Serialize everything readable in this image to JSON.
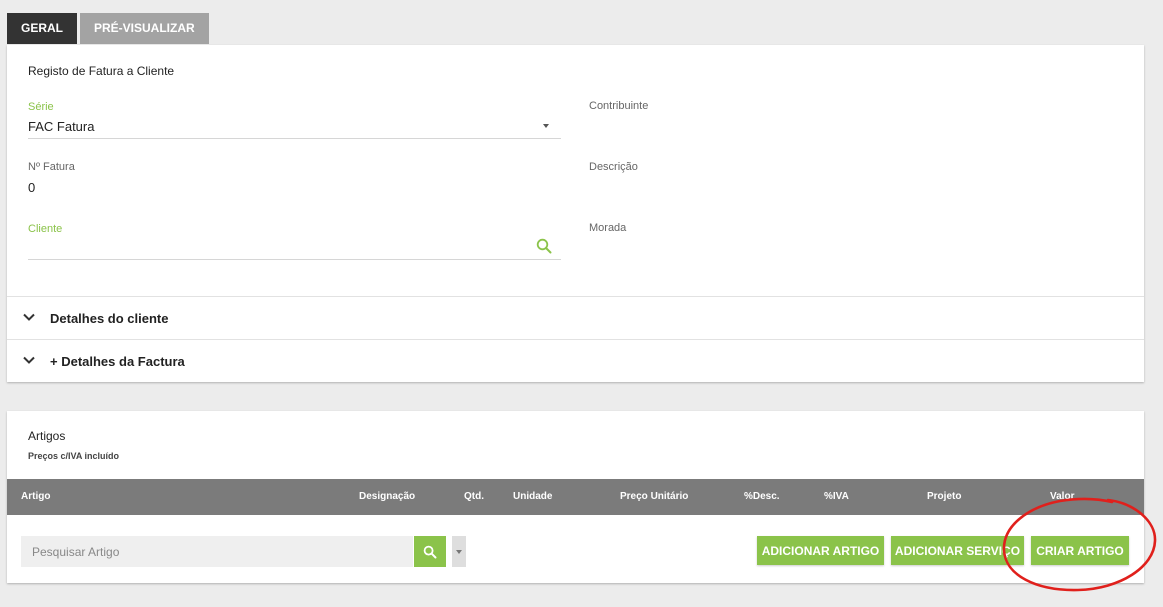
{
  "tabs": [
    {
      "label": "GERAL",
      "active": true
    },
    {
      "label": "PRÉ-VISUALIZAR",
      "active": false
    }
  ],
  "registo": {
    "title": "Registo de Fatura a Cliente",
    "serie": {
      "label": "Série",
      "value": "FAC Fatura"
    },
    "n_fatura": {
      "label": "Nº Fatura",
      "value": "0"
    },
    "cliente": {
      "label": "Cliente",
      "value": ""
    },
    "contribuinte": {
      "label": "Contribuinte"
    },
    "descricao": {
      "label": "Descrição"
    },
    "morada": {
      "label": "Morada"
    },
    "detalhes_cliente": "Detalhes do cliente",
    "detalhes_factura": "+ Detalhes da Factura"
  },
  "artigos": {
    "title": "Artigos",
    "subtitle": "Preços c/IVA incluído",
    "columns": [
      "Artigo",
      "Designação",
      "Qtd.",
      "Unidade",
      "Preço Unitário",
      "%Desc.",
      "%IVA",
      "Projeto",
      "Valor"
    ],
    "search_placeholder": "Pesquisar Artigo",
    "buttons": {
      "adicionar_artigo": "ADICIONAR ARTIGO",
      "adicionar_servico": "ADICIONAR SERVIÇO",
      "criar_artigo": "CRIAR ARTIGO"
    }
  },
  "colors": {
    "accent_green": "#8bc34a",
    "table_header": "#7b7b7b",
    "annotation_red": "#e0201c"
  },
  "icons": [
    "chevron-down-icon",
    "search-icon",
    "caret-down-icon"
  ]
}
